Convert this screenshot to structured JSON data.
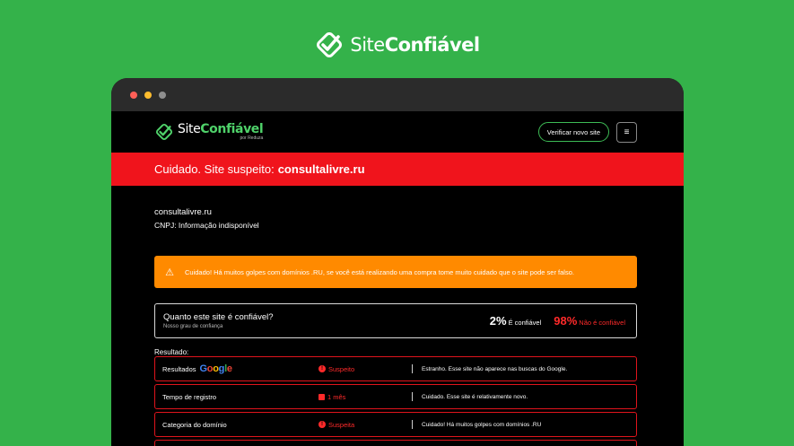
{
  "brand": {
    "name_regular": "Site",
    "name_bold": "Confiável",
    "by": "por Reduza",
    "logo_icon": "check-shield-icon"
  },
  "colors": {
    "background_green": "#34b24a",
    "alert_red": "#f0141c",
    "warning_orange": "#ff8a00",
    "accent_green": "#4fd26a"
  },
  "window": {
    "dots": [
      "#ff5f57",
      "#febc2e",
      "#8e8e8e"
    ]
  },
  "nav": {
    "verify_label": "Verificar novo site",
    "menu_icon": "≡"
  },
  "alert": {
    "prefix": "Cuidado. Site suspeito:",
    "domain": "consultalivre.ru"
  },
  "site": {
    "domain": "consultalivre.ru",
    "cnpj": "CNPJ: Informação indisponível"
  },
  "warning": {
    "icon": "⚠",
    "text": "Cuidado! Há muitos golpes com domínios .RU, se você está realizando uma compra tome muito cuidado que o site pode ser falso."
  },
  "trust": {
    "question": "Quanto este site é confiável?",
    "subtitle": "Nosso grau de confiança",
    "trusted_pct": "2%",
    "trusted_label": "É confiável",
    "untrusted_pct": "98%",
    "untrusted_label": "Não é confiável"
  },
  "results": {
    "label": "Resultado:",
    "rows": [
      {
        "name": "Resultados",
        "extra": "Google",
        "status": "Suspeito",
        "note": "Estranho. Esse site não aparece nas buscas do Google."
      },
      {
        "name": "Tempo de registro",
        "status": "1 mês",
        "note": "Cuidado. Esse site é relativamente novo."
      },
      {
        "name": "Categoria do domínio",
        "status": "Suspeita",
        "note": "Cuidado! Há muitos golpes com domínios .RU"
      }
    ]
  }
}
